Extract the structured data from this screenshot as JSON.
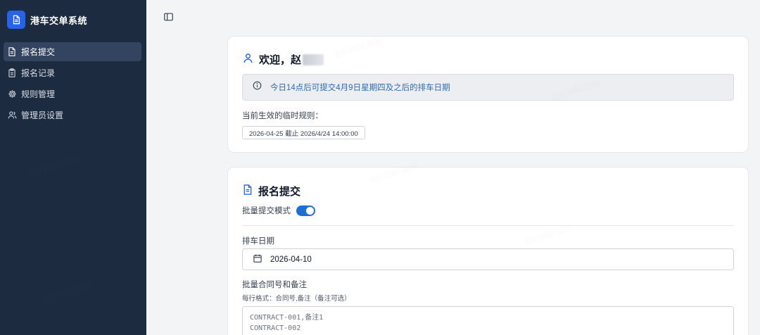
{
  "app": {
    "title": "港车交单系统",
    "accent_color": "#2563eb",
    "sidebar_bg": "#1d2b40"
  },
  "sidebar": {
    "items": [
      {
        "label": "报名提交",
        "icon": "document-icon",
        "active": true
      },
      {
        "label": "报名记录",
        "icon": "clipboard-icon",
        "active": false
      },
      {
        "label": "规则管理",
        "icon": "gear-icon",
        "active": false
      },
      {
        "label": "管理员设置",
        "icon": "users-icon",
        "active": false
      }
    ]
  },
  "welcome": {
    "greeting": "欢迎，赵",
    "icon": "user-icon"
  },
  "notice": {
    "text": "今日14点后可提交4月9日星期四及之后的排车日期",
    "icon": "info-icon",
    "text_color": "#2b6cb0"
  },
  "rules": {
    "label": "当前生效的临时规则：",
    "tag": "2026-04-25 截止 2026/4/24 14:00:00"
  },
  "submit": {
    "title": "报名提交",
    "title_icon": "document-icon",
    "batch_mode_label": "批量提交模式",
    "batch_mode_on": true,
    "date_label": "排车日期",
    "date_value": "2026-04-10",
    "date_icon": "calendar-icon",
    "contracts_label": "批量合同号和备注",
    "contracts_hint": "每行格式：合同号,备注（备注可选）",
    "contracts_lines": [
      "CONTRACT-001,备注1",
      "CONTRACT-002"
    ]
  }
}
